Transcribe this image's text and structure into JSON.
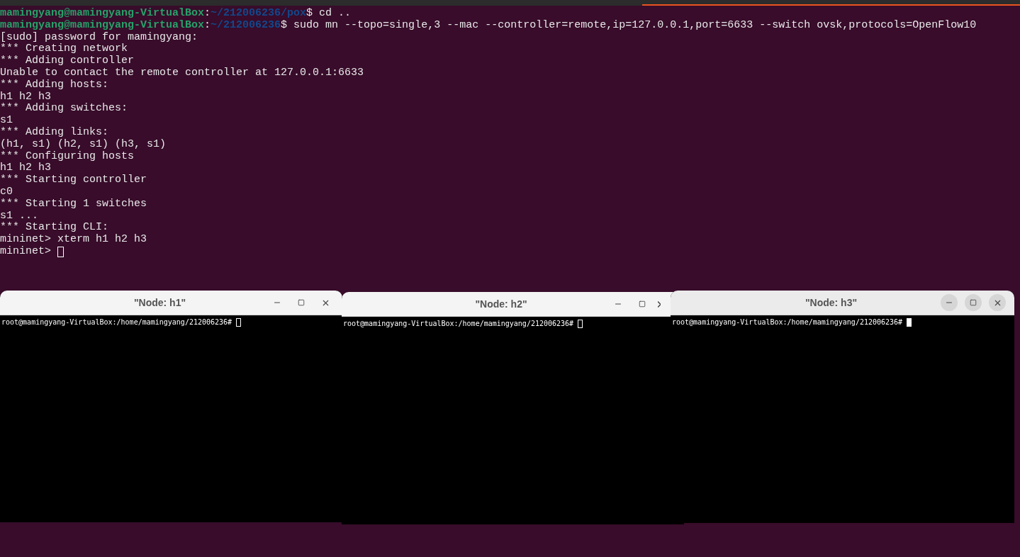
{
  "terminal": {
    "focused": false,
    "lines": [
      {
        "kind": "prompt",
        "parts": [
          {
            "kind": "user",
            "text": "mamingyang@mamingyang-VirtualBox"
          },
          {
            "kind": "plain",
            "text": ":"
          },
          {
            "kind": "path",
            "text": "~/212006236/pox"
          },
          {
            "kind": "plain",
            "text": "$ cd .."
          }
        ]
      },
      {
        "kind": "prompt",
        "parts": [
          {
            "kind": "user",
            "text": "mamingyang@mamingyang-VirtualBox"
          },
          {
            "kind": "plain",
            "text": ":"
          },
          {
            "kind": "path",
            "text": "~/212006236"
          },
          {
            "kind": "plain",
            "text": "$ sudo mn --topo=single,3 --mac --controller=remote,ip=127.0.0.1,port=6633 --switch ovsk,protocols=OpenFlow10"
          }
        ]
      },
      {
        "kind": "text",
        "text": "[sudo] password for mamingyang:"
      },
      {
        "kind": "text",
        "text": "*** Creating network"
      },
      {
        "kind": "text",
        "text": "*** Adding controller"
      },
      {
        "kind": "text",
        "text": "Unable to contact the remote controller at 127.0.0.1:6633"
      },
      {
        "kind": "text",
        "text": "*** Adding hosts:"
      },
      {
        "kind": "text",
        "text": "h1 h2 h3"
      },
      {
        "kind": "text",
        "text": "*** Adding switches:"
      },
      {
        "kind": "text",
        "text": "s1"
      },
      {
        "kind": "text",
        "text": "*** Adding links:"
      },
      {
        "kind": "text",
        "text": "(h1, s1) (h2, s1) (h3, s1)"
      },
      {
        "kind": "text",
        "text": "*** Configuring hosts"
      },
      {
        "kind": "text",
        "text": "h1 h2 h3"
      },
      {
        "kind": "text",
        "text": "*** Starting controller"
      },
      {
        "kind": "text",
        "text": "c0"
      },
      {
        "kind": "text",
        "text": "*** Starting 1 switches"
      },
      {
        "kind": "text",
        "text": "s1 ..."
      },
      {
        "kind": "text",
        "text": "*** Starting CLI:"
      },
      {
        "kind": "text",
        "text": "mininet> xterm h1 h2 h3"
      },
      {
        "kind": "cursor",
        "text": "mininet> "
      }
    ]
  },
  "xterms": [
    {
      "title": "\"Node: h1\"",
      "focused": false,
      "close_clipped": false,
      "prompt": "root@mamingyang-VirtualBox:/home/mamingyang/212006236# "
    },
    {
      "title": "\"Node: h2\"",
      "focused": false,
      "close_clipped": true,
      "prompt": "root@mamingyang-VirtualBox:/home/mamingyang/212006236# "
    },
    {
      "title": "\"Node: h3\"",
      "focused": true,
      "close_clipped": false,
      "prompt": "root@mamingyang-VirtualBox:/home/mamingyang/212006236# "
    }
  ]
}
